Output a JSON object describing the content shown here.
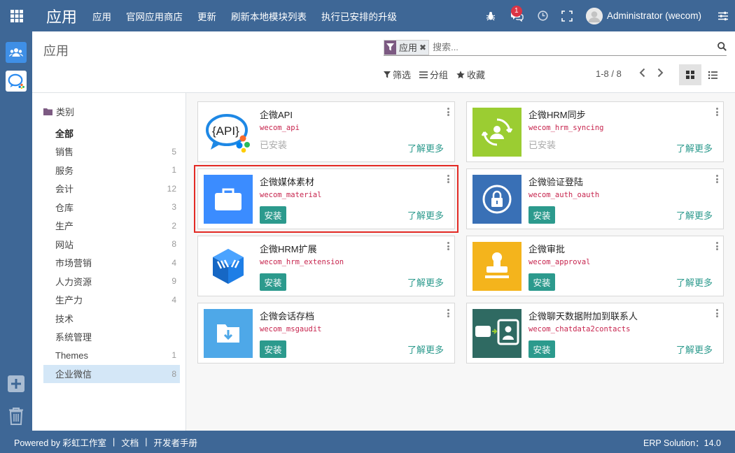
{
  "topbar": {
    "app_title": "应用",
    "menu": [
      "应用",
      "官网应用商店",
      "更新",
      "刷新本地模块列表",
      "执行已安排的升级"
    ],
    "messages_count": "1",
    "user_name": "Administrator (wecom)"
  },
  "control_panel": {
    "title": "应用",
    "facet_label": "应用",
    "search_placeholder": "搜索...",
    "filter_label": "筛选",
    "group_label": "分组",
    "favorite_label": "收藏",
    "pager": "1-8 / 8"
  },
  "categories": {
    "header": "类别",
    "items": [
      {
        "label": "全部",
        "count": ""
      },
      {
        "label": "销售",
        "count": "5"
      },
      {
        "label": "服务",
        "count": "1"
      },
      {
        "label": "会计",
        "count": "12"
      },
      {
        "label": "仓库",
        "count": "3"
      },
      {
        "label": "生产",
        "count": "2"
      },
      {
        "label": "网站",
        "count": "8"
      },
      {
        "label": "市场营销",
        "count": "4"
      },
      {
        "label": "人力资源",
        "count": "9"
      },
      {
        "label": "生产力",
        "count": "4"
      },
      {
        "label": "技术",
        "count": ""
      },
      {
        "label": "系统管理",
        "count": ""
      },
      {
        "label": "Themes",
        "count": "1"
      },
      {
        "label": "企业微信",
        "count": "8"
      }
    ]
  },
  "apps": [
    {
      "name": "企微API",
      "technical": "wecom_api",
      "status": "已安装",
      "learn_more": "了解更多",
      "icon": "api-icon"
    },
    {
      "name": "企微HRM同步",
      "technical": "wecom_hrm_syncing",
      "status": "已安装",
      "learn_more": "了解更多",
      "icon": "sync-user-icon"
    },
    {
      "name": "企微媒体素材",
      "technical": "wecom_material",
      "status": "安装",
      "learn_more": "了解更多",
      "icon": "briefcase-icon"
    },
    {
      "name": "企微验证登陆",
      "technical": "wecom_auth_oauth",
      "status": "安装",
      "learn_more": "了解更多",
      "icon": "lock-icon"
    },
    {
      "name": "企微HRM扩展",
      "technical": "wecom_hrm_extension",
      "status": "安装",
      "learn_more": "了解更多",
      "icon": "hrm-cube-icon"
    },
    {
      "name": "企微审批",
      "technical": "wecom_approval",
      "status": "安装",
      "learn_more": "了解更多",
      "icon": "stamp-icon"
    },
    {
      "name": "企微会话存档",
      "technical": "wecom_msgaudit",
      "status": "安装",
      "learn_more": "了解更多",
      "icon": "archive-icon"
    },
    {
      "name": "企微聊天数据附加到联系人",
      "technical": "wecom_chatdata2contacts",
      "status": "安装",
      "learn_more": "了解更多",
      "icon": "contacts-icon"
    }
  ],
  "footer": {
    "powered_by": "Powered by 彩虹工作室",
    "docs": "文档",
    "dev_manual": "开发者手册",
    "version": "ERP Solution：14.0"
  },
  "colors": {
    "navbar": "#3e6796",
    "accent": "#2c9a8d",
    "technical_name": "#c7254e",
    "highlight": "#e32a24",
    "active_category": "#d4e7f7"
  }
}
